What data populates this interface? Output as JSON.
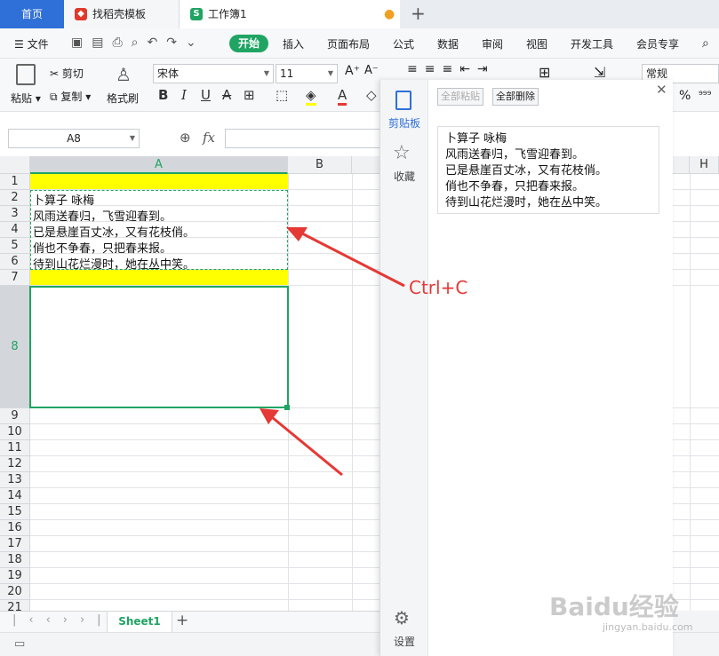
{
  "tabs": {
    "home": "首页",
    "template": "找稻壳模板",
    "workbook": "工作簿1",
    "new_tab": "+"
  },
  "menu": {
    "file": "文件",
    "items": [
      "开始",
      "插入",
      "页面布局",
      "公式",
      "数据",
      "审阅",
      "视图",
      "开发工具",
      "会员专享"
    ]
  },
  "ribbon": {
    "paste": "粘贴",
    "cut": "剪切",
    "copy": "复制",
    "format_painter": "格式刷",
    "font_name": "宋体",
    "font_size": "11",
    "number_format": "常规",
    "bold": "B",
    "italic": "I",
    "underline": "U",
    "strike": "A",
    "font_color": "A",
    "percent": "%"
  },
  "formula_bar": {
    "name_box": "A8",
    "fx": "fx"
  },
  "grid": {
    "columns": [
      "A",
      "B",
      "H"
    ],
    "rows": [
      "1",
      "2",
      "3",
      "4",
      "5",
      "6",
      "7",
      "8",
      "9",
      "10",
      "11",
      "12",
      "13",
      "14",
      "15",
      "16",
      "17",
      "18",
      "19",
      "20",
      "21"
    ],
    "cells": {
      "A2": "卜算子    咏梅",
      "A3": "风雨送春归，飞雪迎春到。",
      "A4": "已是悬崖百丈冰，又有花枝俏。",
      "A5": "俏也不争春，只把春来报。",
      "A6": "待到山花烂漫时，她在丛中笑。"
    },
    "highlight_color": "#ffff00",
    "selection_color": "#1fa463"
  },
  "sheets": {
    "active": "Sheet1",
    "add": "+"
  },
  "clipboard_pane": {
    "tab_clipboard": "剪贴板",
    "tab_favorites": "收藏",
    "settings": "设置",
    "paste_all": "全部粘贴",
    "delete_all": "全部删除",
    "item_lines": [
      "卜算子    咏梅",
      "风雨送春归，飞雪迎春到。",
      "已是悬崖百丈冰，又有花枝俏。",
      "俏也不争春，只把春来报。",
      "待到山花烂漫时，她在丛中笑。"
    ]
  },
  "annotation": {
    "shortcut": "Ctrl+C",
    "color": "#e53935"
  },
  "watermark": {
    "main": "Baidu经验",
    "sub": "jingyan.baidu.com"
  }
}
